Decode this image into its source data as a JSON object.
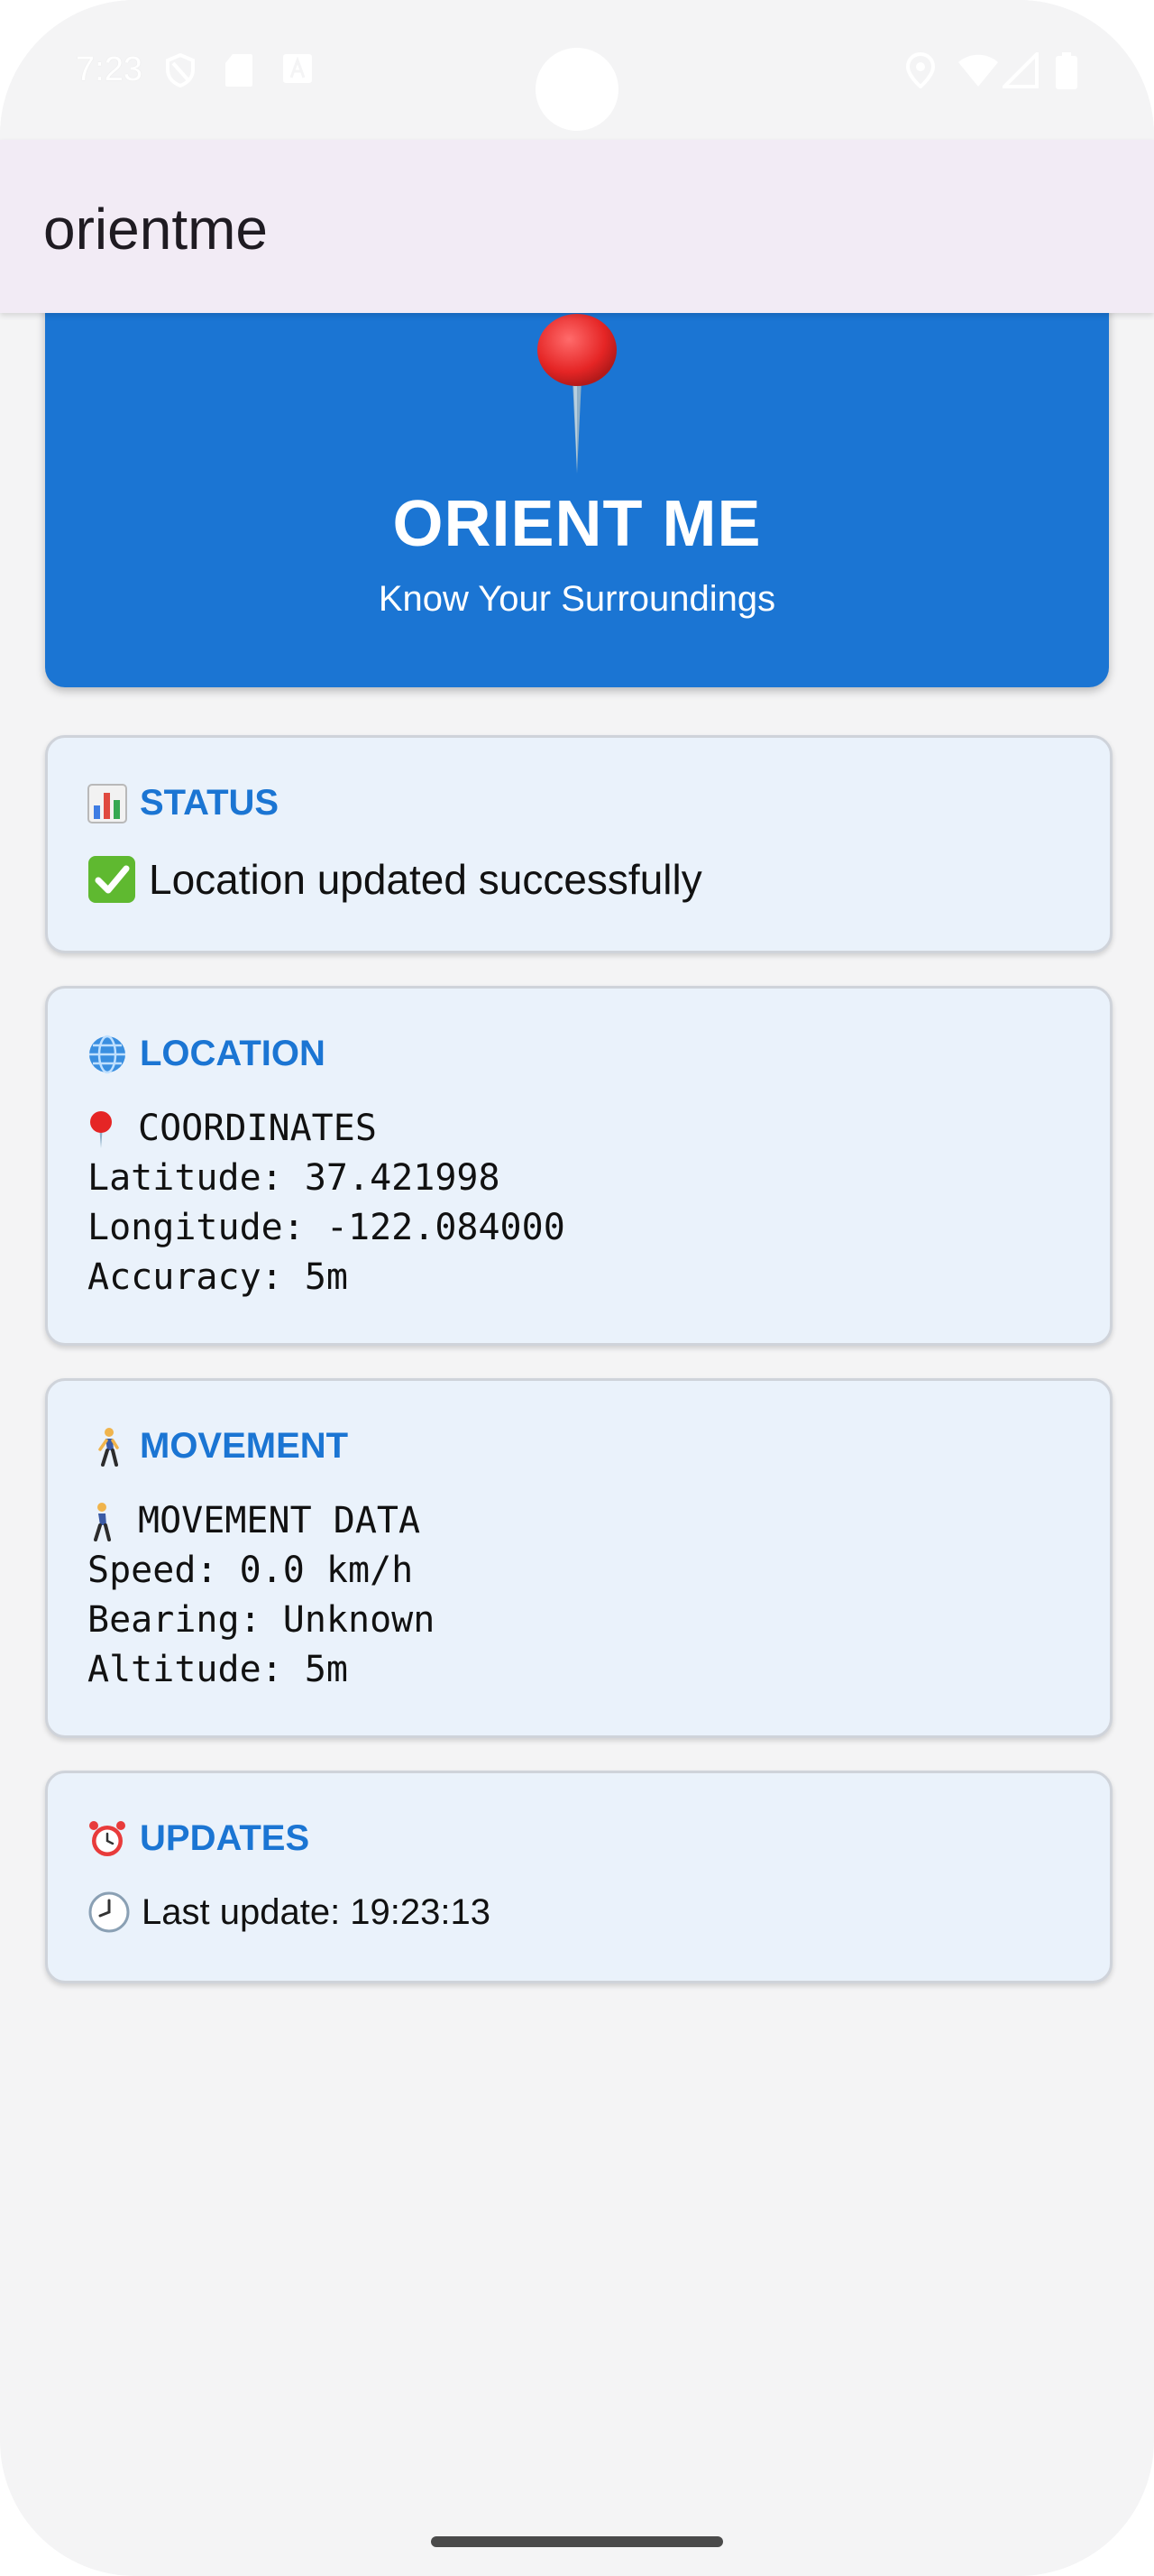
{
  "status_bar": {
    "time": "7:23",
    "icons": [
      "shield-icon",
      "sd-card-icon",
      "keyboard-a-icon",
      "location-icon",
      "wifi-icon",
      "signal-icon",
      "battery-icon"
    ]
  },
  "app_bar": {
    "title": "orientme"
  },
  "hero": {
    "icon": "pushpin-icon",
    "title": "ORIENT ME",
    "subtitle": "Know Your Surroundings",
    "color": "#1b75d3"
  },
  "status_card": {
    "icon": "bar-chart-icon",
    "title": "STATUS",
    "message_icon": "check-mark-icon",
    "message": "Location updated successfully"
  },
  "location_card": {
    "icon": "globe-icon",
    "title": "LOCATION",
    "heading_icon": "pushpin-icon",
    "heading": "COORDINATES",
    "latitude": "Latitude: 37.421998",
    "longitude": "Longitude: -122.084000",
    "accuracy": "Accuracy: 5m"
  },
  "movement_card": {
    "icon": "walking-person-icon",
    "title": "MOVEMENT",
    "heading_icon": "walking-person-icon",
    "heading": "MOVEMENT DATA",
    "speed": "Speed: 0.0 km/h",
    "bearing": "Bearing: Unknown",
    "altitude": "Altitude: 5m"
  },
  "updates_card": {
    "icon": "alarm-clock-icon",
    "title": "UPDATES",
    "message_icon": "clock-icon",
    "message": "Last update: 19:23:13"
  },
  "accent_color": "#1b75d3"
}
